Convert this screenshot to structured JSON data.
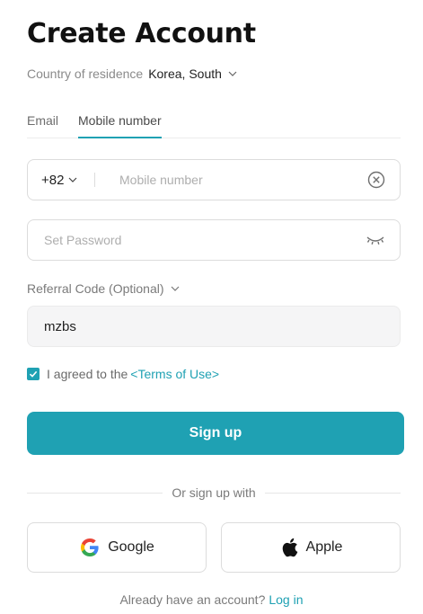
{
  "page": {
    "title": "Create Account"
  },
  "country": {
    "label": "Country of residence",
    "value": "Korea, South"
  },
  "tabs": [
    {
      "label": "Email",
      "active": false
    },
    {
      "label": "Mobile number",
      "active": true
    }
  ],
  "phone": {
    "dial_code": "+82",
    "placeholder": "Mobile number",
    "value": ""
  },
  "password": {
    "placeholder": "Set Password",
    "value": ""
  },
  "referral": {
    "label": "Referral Code (Optional)",
    "value": "mzbs"
  },
  "agreement": {
    "checked": true,
    "text": "I agreed to the",
    "link": "<Terms of Use>"
  },
  "signup": {
    "label": "Sign up"
  },
  "social": {
    "divider": "Or sign up with",
    "google": "Google",
    "apple": "Apple"
  },
  "login": {
    "prompt": "Already have an account?",
    "link": "Log in"
  },
  "colors": {
    "accent": "#1fa1b3"
  }
}
